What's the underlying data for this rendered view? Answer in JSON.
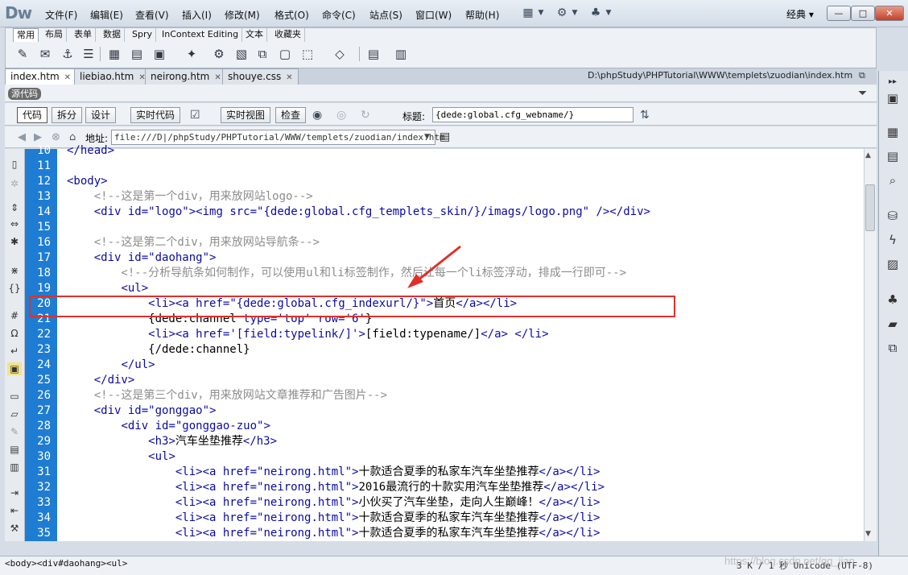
{
  "app": {
    "logo": "Dw"
  },
  "menu": [
    "文件(F)",
    "编辑(E)",
    "查看(V)",
    "插入(I)",
    "修改(M)",
    "格式(O)",
    "命令(C)",
    "站点(S)",
    "窗口(W)",
    "帮助(H)"
  ],
  "workspace": {
    "label": "经典 ▾"
  },
  "window_buttons": {
    "minimize": "—",
    "maximize": "□",
    "close": "✕"
  },
  "insert_tabs": [
    "常用",
    "布局",
    "表单",
    "数据",
    "Spry",
    "InContext Editing",
    "文本",
    "收藏夹"
  ],
  "doc_tabs": [
    "index.htm",
    "liebiao.htm",
    "neirong.htm",
    "shouye.css"
  ],
  "doc_path": "D:\\phpStudy\\PHPTutorial\\WWW\\templets\\zuodian\\index.htm",
  "source_badge": "源代码",
  "doc_toolbar": {
    "code": "代码",
    "split": "拆分",
    "design": "设计",
    "live_code": "实时代码",
    "live_view": "实时视图",
    "inspect": "检查",
    "title_label": "标题:",
    "title_value": "{dede:global.cfg_webname/}"
  },
  "address": {
    "label": "地址:",
    "value": "file:///D|/phpStudy/PHPTutorial/WWW/templets/zuodian/index.htm"
  },
  "code_lines": [
    {
      "n": "10",
      "text": "</head>"
    },
    {
      "n": "11",
      "text": ""
    },
    {
      "n": "12",
      "text": "<body>"
    },
    {
      "n": "13",
      "text": "    <!--这是第一个div，用来放网站logo-->"
    },
    {
      "n": "14",
      "text": "    <div id=\"logo\"><img src=\"{dede:global.cfg_templets_skin/}/imags/logo.png\" /></div>"
    },
    {
      "n": "15",
      "text": ""
    },
    {
      "n": "16",
      "text": "    <!--这是第二个div，用来放网站导航条-->"
    },
    {
      "n": "17",
      "text": "    <div id=\"daohang\">"
    },
    {
      "n": "18",
      "text": "        <!--分析导航条如何制作，可以使用ul和li标签制作，然后让每一个li标签浮动，排成一行即可-->"
    },
    {
      "n": "19",
      "text": "        <ul>"
    },
    {
      "n": "20",
      "text": "            <li><a href=\"{dede:global.cfg_indexurl/}\">首页</a></li>"
    },
    {
      "n": "21",
      "text": "            {dede:channel type='top' row='6'}"
    },
    {
      "n": "22",
      "text": "            <li><a href='[field:typelink/]'>[field:typename/]</a> </li>"
    },
    {
      "n": "23",
      "text": "            {/dede:channel}"
    },
    {
      "n": "24",
      "text": "        </ul>"
    },
    {
      "n": "25",
      "text": "    </div>"
    },
    {
      "n": "26",
      "text": "    <!--这是第三个div，用来放网站文章推荐和广告图片-->"
    },
    {
      "n": "27",
      "text": "    <div id=\"gonggao\">"
    },
    {
      "n": "28",
      "text": "        <div id=\"gonggao-zuo\">"
    },
    {
      "n": "29",
      "text": "            <h3>汽车坐垫推荐</h3>"
    },
    {
      "n": "30",
      "text": "            <ul>"
    },
    {
      "n": "31",
      "text": "                <li><a href=\"neirong.html\">十款适合夏季的私家车汽车坐垫推荐</a></li>"
    },
    {
      "n": "32",
      "text": "                <li><a href=\"neirong.html\">2016最流行的十款实用汽车坐垫推荐</a></li>"
    },
    {
      "n": "33",
      "text": "                <li><a href=\"neirong.html\">小伙买了汽车坐垫，走向人生巅峰！</a></li>"
    },
    {
      "n": "34",
      "text": "                <li><a href=\"neirong.html\">十款适合夏季的私家车汽车坐垫推荐</a></li>"
    },
    {
      "n": "35",
      "text": "                <li><a href=\"neirong.html\">十款适合夏季的私家车汽车坐垫推荐</a></li>"
    }
  ],
  "status": {
    "tag_selector": "<body><div#daohang><ul>",
    "right": "3 K / 1 秒  Unicode (UTF-8)",
    "watermark": "https://blog.csdn.net/qq_jian"
  },
  "highlight_color": "#e0302a",
  "gutter_color": "#1e7cd2"
}
